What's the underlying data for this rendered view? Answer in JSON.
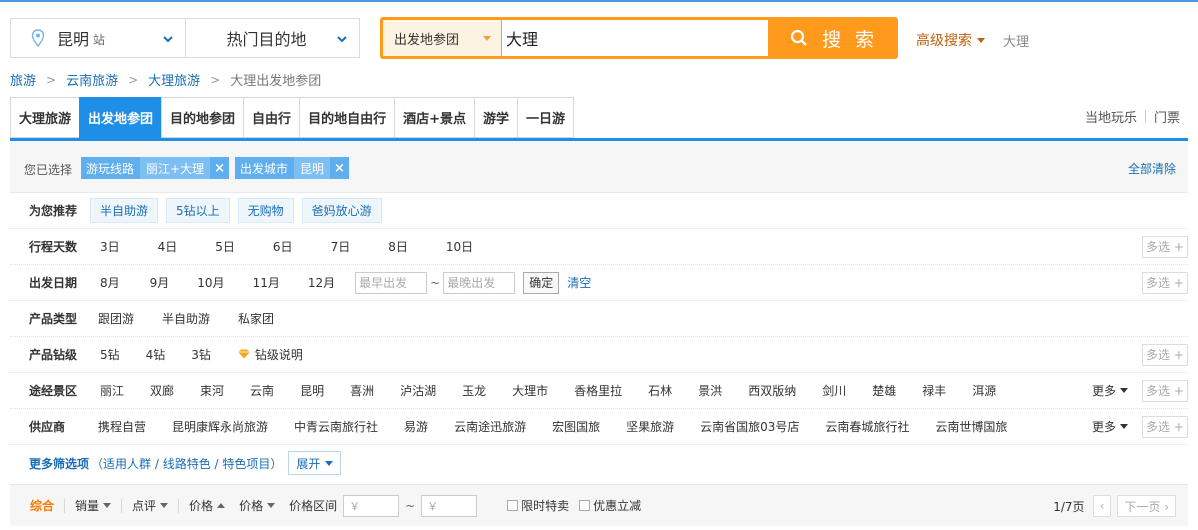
{
  "header": {
    "city": "昆明",
    "city_suffix": "站",
    "hot_destinations": "热门目的地",
    "depart_select": "出发地参团",
    "search_value": "大理",
    "search_button": "搜 索",
    "advanced_search": "高级搜索",
    "history_keyword": "大理"
  },
  "breadcrumb": [
    "旅游",
    "云南旅游",
    "大理旅游",
    "大理出发地参团"
  ],
  "tabs": [
    "大理旅游",
    "出发地参团",
    "目的地参团",
    "自由行",
    "目的地自由行",
    "酒店+景点",
    "游学",
    "一日游"
  ],
  "active_tab": "出发地参团",
  "side_links": [
    "当地玩乐",
    "门票"
  ],
  "selected": {
    "label": "您已选择",
    "chips": [
      {
        "key": "游玩线路",
        "value": "丽江+大理"
      },
      {
        "key": "出发城市",
        "value": "昆明"
      }
    ],
    "clear_all": "全部清除"
  },
  "filters": {
    "recommend": {
      "label": "为您推荐",
      "options": [
        "半自助游",
        "5钻以上",
        "无购物",
        "爸妈放心游"
      ]
    },
    "days": {
      "label": "行程天数",
      "options": [
        "3日",
        "4日",
        "5日",
        "6日",
        "7日",
        "8日",
        "10日"
      ],
      "multi": "多选"
    },
    "date": {
      "label": "出发日期",
      "options": [
        "8月",
        "9月",
        "10月",
        "11月",
        "12月"
      ],
      "start_ph": "最早出发",
      "tilde": "~",
      "end_ph": "最晚出发",
      "ok": "确定",
      "clear": "清空",
      "multi": "多选"
    },
    "type": {
      "label": "产品类型",
      "options": [
        "跟团游",
        "半自助游",
        "私家团"
      ]
    },
    "level": {
      "label": "产品钻级",
      "options": [
        "5钻",
        "4钻",
        "3钻"
      ],
      "explain": "钻级说明",
      "multi": "多选"
    },
    "spots": {
      "label": "途经景区",
      "options": [
        "丽江",
        "双廊",
        "束河",
        "云南",
        "昆明",
        "喜洲",
        "泸沽湖",
        "玉龙",
        "大理市",
        "香格里拉",
        "石林",
        "景洪",
        "西双版纳",
        "剑川",
        "楚雄",
        "禄丰",
        "洱源"
      ],
      "more": "更多",
      "multi": "多选"
    },
    "supplier": {
      "label": "供应商",
      "options": [
        "携程自营",
        "昆明康辉永尚旅游",
        "中青云南旅行社",
        "易游",
        "云南途迅旅游",
        "宏图国旅",
        "坚果旅游",
        "云南省国旅03号店",
        "云南春城旅行社",
        "云南世博国旅"
      ],
      "more": "更多",
      "multi": "多选"
    }
  },
  "more_filters": {
    "title": "更多筛选项",
    "sub": "（适用人群 / 线路特色 / 特色项目）",
    "expand": "展开"
  },
  "sortbar": {
    "items": [
      "综合",
      "销量",
      "点评",
      "价格",
      "价格",
      "价格区间"
    ],
    "currency": "￥",
    "tilde": "~",
    "checkbox1": "限时特卖",
    "checkbox2": "优惠立减",
    "page": "1/7页",
    "prev": "‹",
    "next": "下一页 ›"
  },
  "colors": {
    "accent_blue": "#1e8ee6",
    "search_orange": "#ff9a1c",
    "link_blue": "#1a6db5",
    "active_orange": "#ff7a00"
  }
}
